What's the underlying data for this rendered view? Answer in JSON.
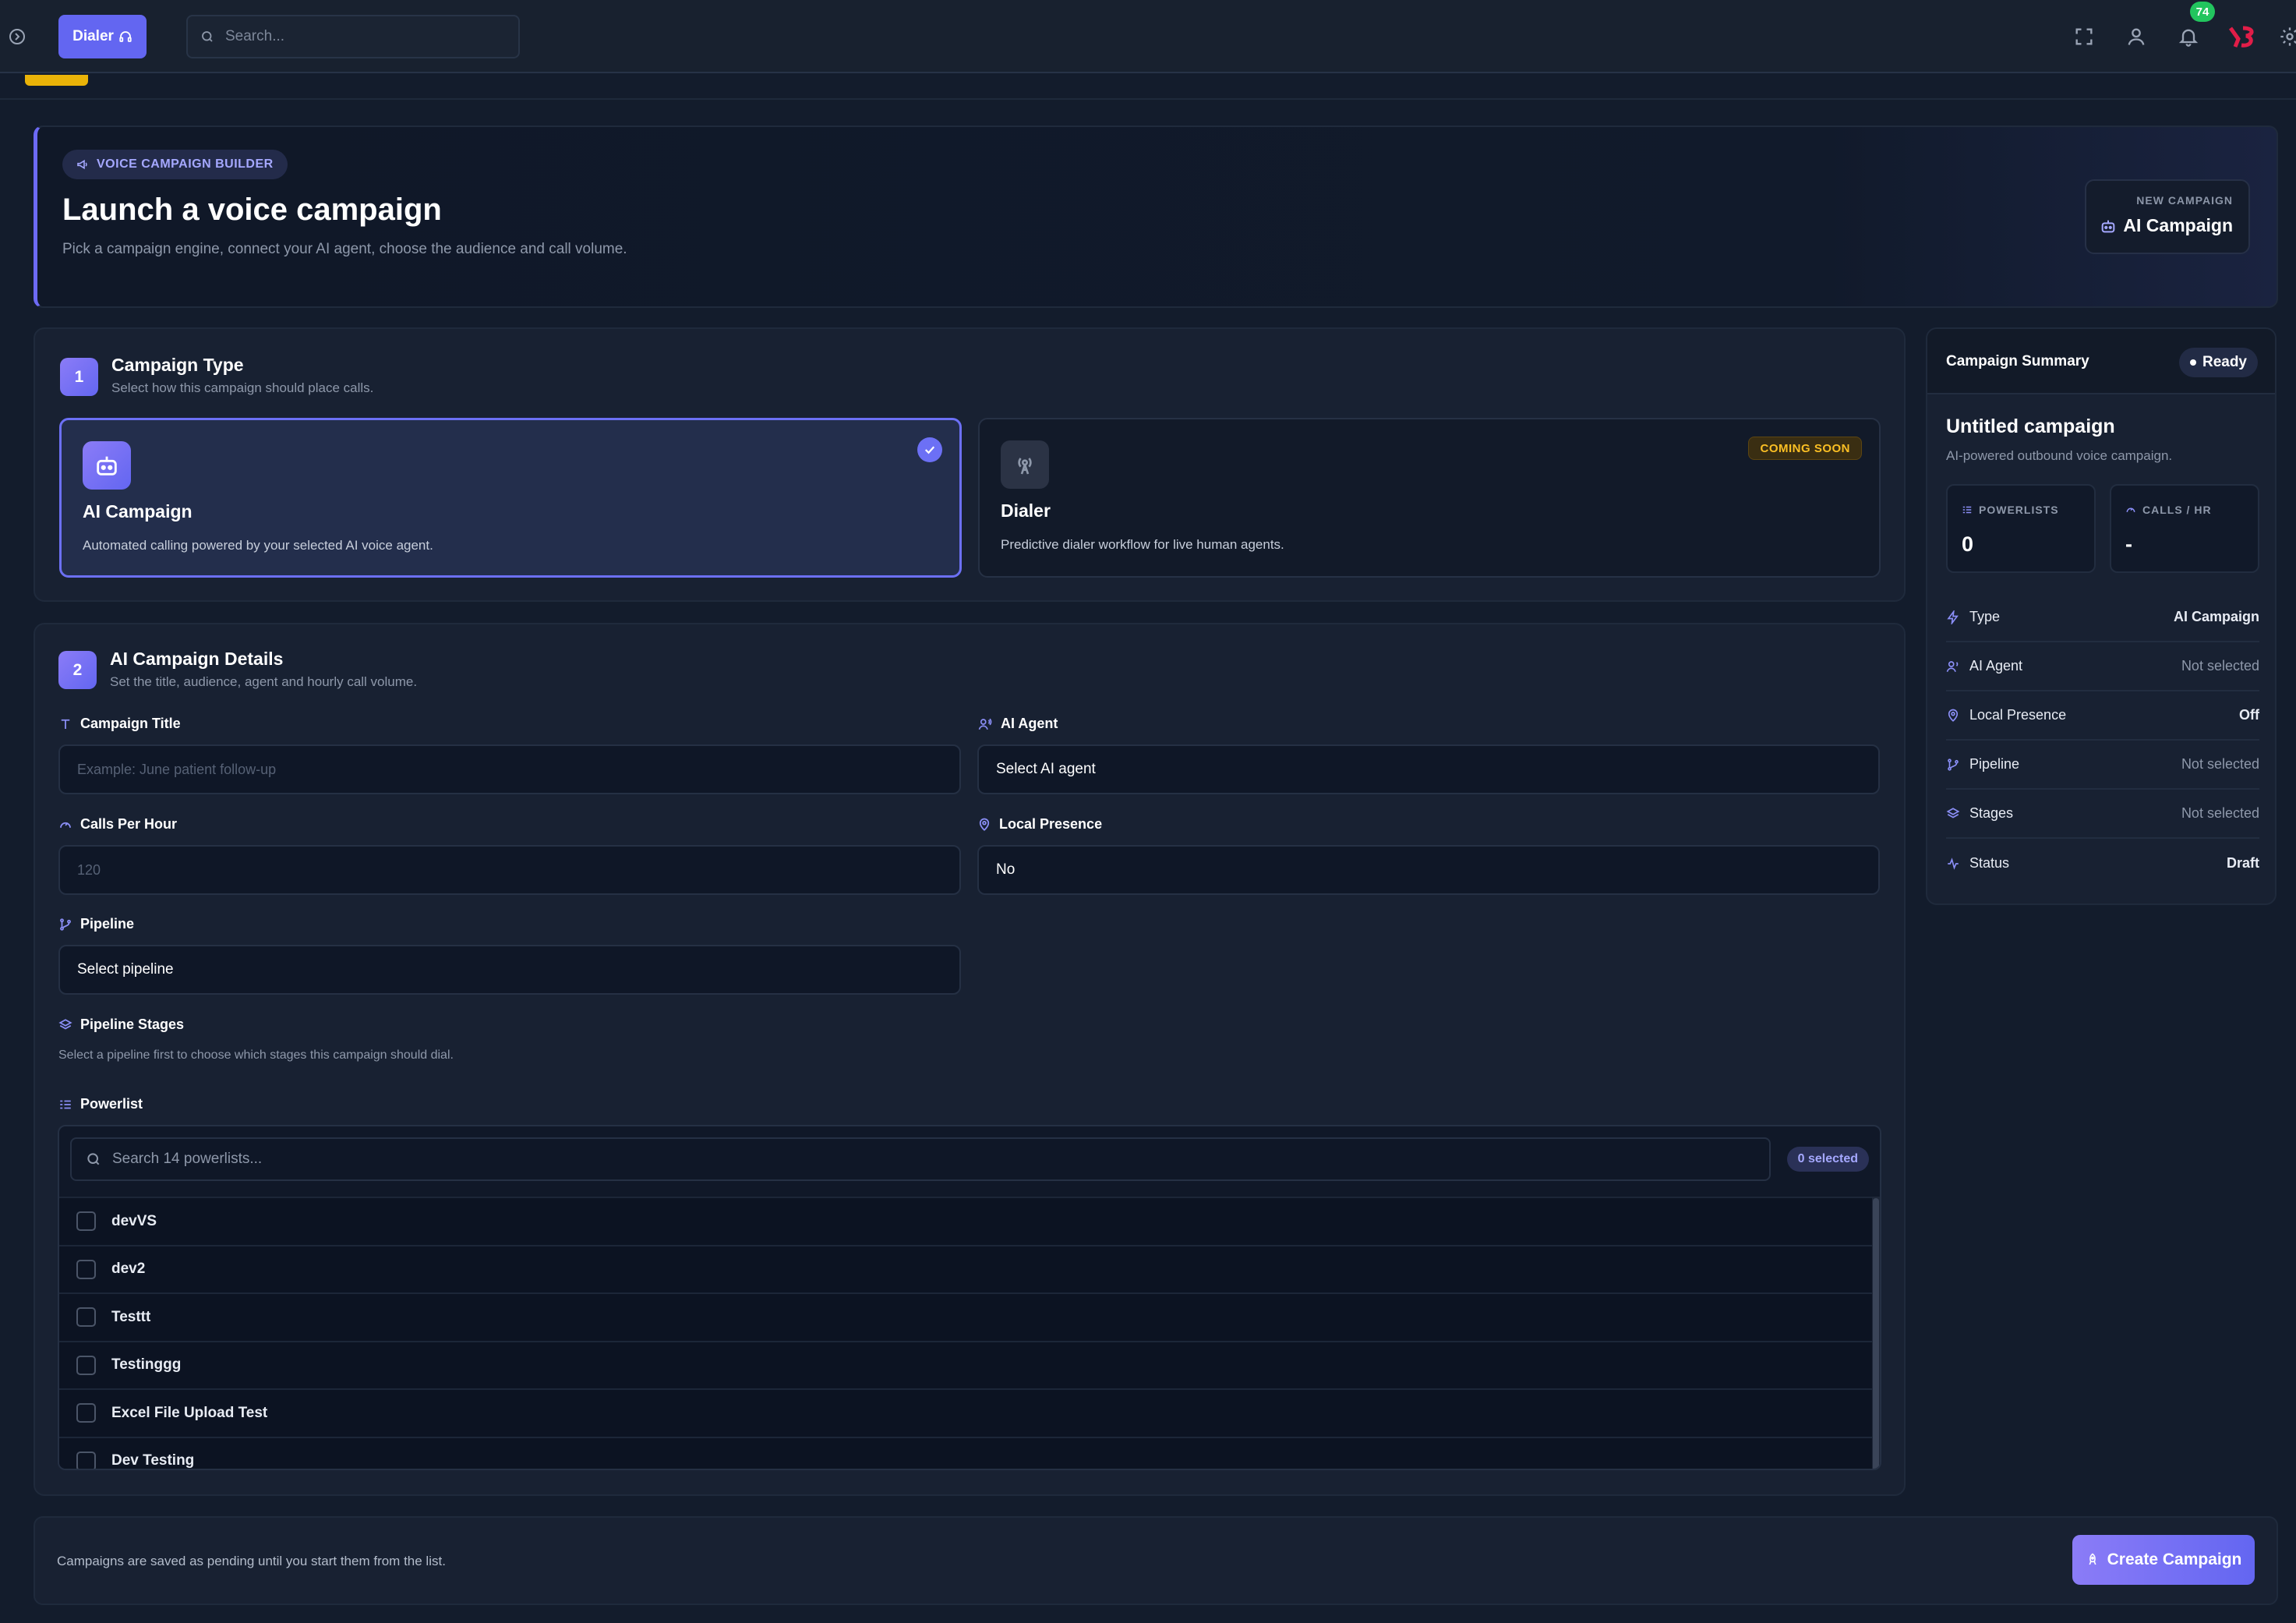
{
  "topbar": {
    "dialer_label": "Dialer",
    "search_placeholder": "Search...",
    "notification_count": "74"
  },
  "hero": {
    "pill": "VOICE CAMPAIGN BUILDER",
    "title": "Launch a voice campaign",
    "subtitle": "Pick a campaign engine, connect your AI agent, choose the audience and call volume.",
    "new_campaign_label": "NEW CAMPAIGN",
    "new_campaign_value": "AI Campaign"
  },
  "step1": {
    "num": "1",
    "title": "Campaign Type",
    "subtitle": "Select how this campaign should place calls.",
    "options": [
      {
        "name": "AI Campaign",
        "desc": "Automated calling powered by your selected AI voice agent.",
        "selected": true
      },
      {
        "name": "Dialer",
        "desc": "Predictive dialer workflow for live human agents.",
        "badge": "COMING SOON"
      }
    ]
  },
  "step2": {
    "num": "2",
    "title": "AI Campaign Details",
    "subtitle": "Set the title, audience, agent and hourly call volume.",
    "campaign_title": {
      "label": "Campaign Title",
      "placeholder": "Example: June patient follow-up"
    },
    "ai_agent": {
      "label": "AI Agent",
      "value": "Select AI agent"
    },
    "calls_per_hour": {
      "label": "Calls Per Hour",
      "placeholder": "120"
    },
    "local_presence": {
      "label": "Local Presence",
      "value": "No"
    },
    "pipeline": {
      "label": "Pipeline",
      "value": "Select pipeline"
    },
    "pipeline_stages": {
      "label": "Pipeline Stages",
      "hint": "Select a pipeline first to choose which stages this campaign should dial."
    },
    "powerlist": {
      "label": "Powerlist",
      "search_placeholder": "Search 14 powerlists...",
      "selected_badge": "0 selected",
      "items": [
        "devVS",
        "dev2",
        "Testtt",
        "Testinggg",
        "Excel File Upload Test",
        "Dev Testing"
      ]
    }
  },
  "summary": {
    "title": "Campaign Summary",
    "status_badge": "Ready",
    "name": "Untitled campaign",
    "desc": "AI-powered outbound voice campaign.",
    "powerlists_label": "POWERLISTS",
    "powerlists_value": "0",
    "calls_label": "CALLS / HR",
    "calls_value": "-",
    "rows": [
      {
        "label": "Type",
        "value": "AI Campaign"
      },
      {
        "label": "AI Agent",
        "value": "Not selected"
      },
      {
        "label": "Local Presence",
        "value": "Off"
      },
      {
        "label": "Pipeline",
        "value": "Not selected"
      },
      {
        "label": "Stages",
        "value": "Not selected"
      },
      {
        "label": "Status",
        "value": "Draft"
      }
    ]
  },
  "footer": {
    "note": "Campaigns are saved as pending until you start them from the list.",
    "create_label": "Create Campaign"
  },
  "colors": {
    "accent": "#6366f1",
    "accent_light": "#8b7cf7",
    "background": "#131c2c",
    "warning": "#fbbf24",
    "success": "#22c55e"
  }
}
